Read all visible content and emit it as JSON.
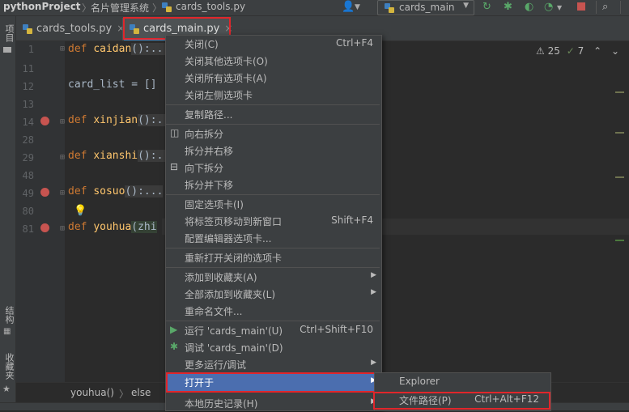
{
  "breadcrumb": {
    "project": "pythonProject",
    "folder": "名片管理系统",
    "file": "cards_tools.py"
  },
  "toolbar": {
    "run_config": "cards_main"
  },
  "left_strip": {
    "project": "项目",
    "structure": "结构",
    "favorites": "收藏夹"
  },
  "tabs": [
    {
      "label": "cards_tools.py",
      "close": "×"
    },
    {
      "label": "cards_main.py",
      "close": "×"
    }
  ],
  "editor": {
    "lines": [
      {
        "num": "1",
        "kw": "def",
        "name": "caidan",
        "rest": "():..."
      },
      {
        "num": "11",
        "text": ""
      },
      {
        "num": "12",
        "text": "card_list = []"
      },
      {
        "num": "13",
        "text": ""
      },
      {
        "num": "14",
        "kw": "def",
        "name": "xinjian",
        "rest": "():..."
      },
      {
        "num": "28",
        "text": ""
      },
      {
        "num": "29",
        "kw": "def",
        "name": "xianshi",
        "rest": "():..."
      },
      {
        "num": "48",
        "text": ""
      },
      {
        "num": "49",
        "kw": "def",
        "name": "sosuo",
        "rest": "():..."
      },
      {
        "num": "80",
        "text": ""
      },
      {
        "num": "81",
        "kw": "def",
        "name": "youhua",
        "rest": "(zhi"
      }
    ],
    "warnings": "25",
    "weak_warnings": "7"
  },
  "bottom_crumbs": {
    "func": "youhua()",
    "sep": "〉",
    "branch": "else"
  },
  "context_menu": {
    "close": {
      "label": "关闭(C)",
      "shortcut": "Ctrl+F4"
    },
    "close_others": "关闭其他选项卡(O)",
    "close_all": "关闭所有选项卡(A)",
    "close_left": "关闭左侧选项卡",
    "copy_path": "复制路径...",
    "split_right": "向右拆分",
    "split_move_right": "拆分并右移",
    "split_down": "向下拆分",
    "split_move_down": "拆分并下移",
    "pin_tab": "固定选项卡(I)",
    "move_new_window": {
      "label": "将标签页移动到新窗口",
      "shortcut": "Shift+F4"
    },
    "config_tabs": "配置编辑器选项卡...",
    "reopen_closed": "重新打开关闭的选项卡",
    "add_favorites": "添加到收藏夹(A)",
    "add_all_favorites": "全部添加到收藏夹(L)",
    "rename_file": "重命名文件...",
    "run": {
      "label": "运行 'cards_main'(U)",
      "shortcut": "Ctrl+Shift+F10"
    },
    "debug": "调试 'cards_main'(D)",
    "more_run": "更多运行/调试",
    "open_in": "打开于",
    "local_history": "本地历史记录(H)"
  },
  "submenu": {
    "explorer": "Explorer",
    "file_path": {
      "label": "文件路径(P)",
      "shortcut": "Ctrl+Alt+F12"
    }
  },
  "colors": {
    "accent": "#4b6eaf",
    "highlight_box": "#e0262b",
    "keyword": "#cc7832",
    "function": "#ffc66d"
  }
}
